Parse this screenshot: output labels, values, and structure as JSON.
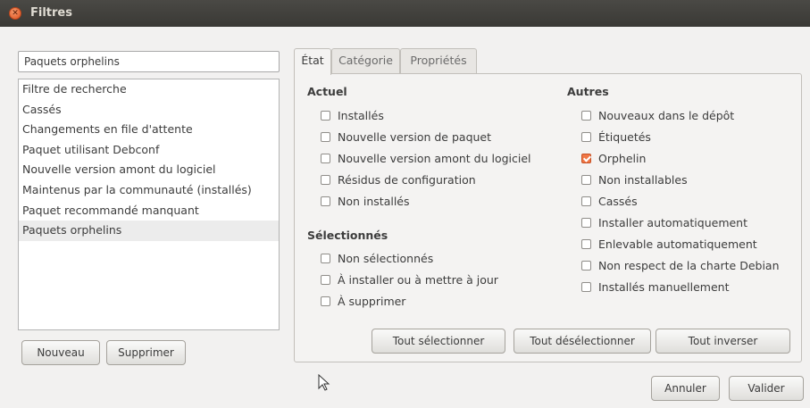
{
  "window": {
    "title": "Filtres"
  },
  "search": {
    "value": "Paquets orphelins"
  },
  "filters": {
    "items": [
      {
        "label": "Filtre de recherche"
      },
      {
        "label": "Cassés"
      },
      {
        "label": "Changements en file d'attente"
      },
      {
        "label": "Paquet utilisant Debconf"
      },
      {
        "label": "Nouvelle version amont du logiciel"
      },
      {
        "label": "Maintenus par la communauté (installés)"
      },
      {
        "label": "Paquet recommandé manquant"
      },
      {
        "label": "Paquets orphelins"
      }
    ],
    "selected": "Paquets orphelins"
  },
  "left_buttons": {
    "new": "Nouveau",
    "delete": "Supprimer"
  },
  "tabs": [
    {
      "label": "État"
    },
    {
      "label": "Catégorie"
    },
    {
      "label": "Propriétés"
    }
  ],
  "status": {
    "current": {
      "title": "Actuel",
      "items": [
        {
          "label": "Installés",
          "checked": false
        },
        {
          "label": "Nouvelle version de paquet",
          "checked": false
        },
        {
          "label": "Nouvelle version amont du logiciel",
          "checked": false
        },
        {
          "label": "Résidus de configuration",
          "checked": false
        },
        {
          "label": "Non installés",
          "checked": false
        }
      ]
    },
    "selected": {
      "title": "Sélectionnés",
      "items": [
        {
          "label": "Non sélectionnés",
          "checked": false
        },
        {
          "label": "À installer ou à mettre à jour",
          "checked": false
        },
        {
          "label": "À supprimer",
          "checked": false
        }
      ]
    },
    "other": {
      "title": "Autres",
      "items": [
        {
          "label": "Nouveaux dans le dépôt",
          "checked": false
        },
        {
          "label": "Étiquetés",
          "checked": false
        },
        {
          "label": "Orphelin",
          "checked": true
        },
        {
          "label": "Non installables",
          "checked": false
        },
        {
          "label": "Cassés",
          "checked": false
        },
        {
          "label": "Installer automatiquement",
          "checked": false
        },
        {
          "label": "Enlevable automatiquement",
          "checked": false
        },
        {
          "label": "Non respect de la charte Debian",
          "checked": false
        },
        {
          "label": "Installés manuellement",
          "checked": false
        }
      ]
    }
  },
  "panel_buttons": {
    "select_all": "Tout sélectionner",
    "deselect_all": "Tout désélectionner",
    "invert": "Tout inverser"
  },
  "dialog_buttons": {
    "cancel": "Annuler",
    "ok": "Valider"
  },
  "colors": {
    "titlebar": "#3c3b37",
    "accent": "#f07746",
    "window_bg": "#f2f1f0"
  }
}
